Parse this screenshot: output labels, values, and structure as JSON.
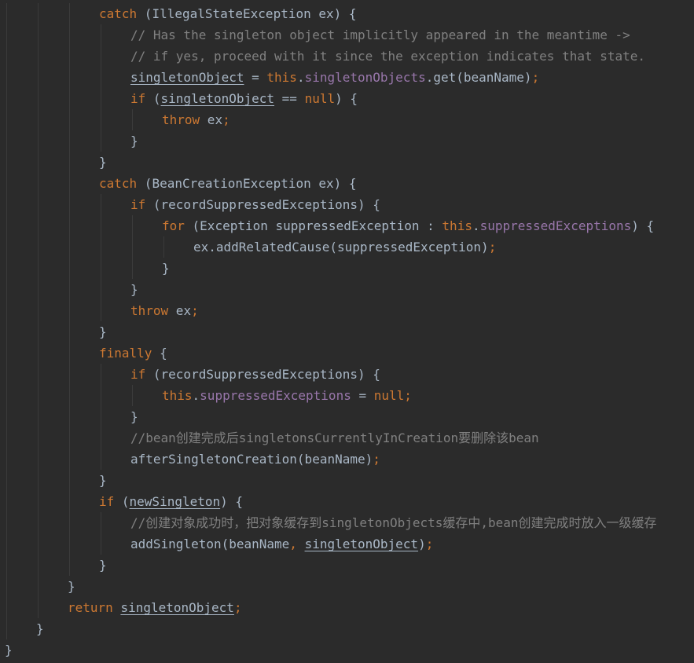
{
  "editor": {
    "language": "Java",
    "theme_colors": {
      "background": "#2b2b2b",
      "plain": "#a9b7c6",
      "keyword": "#cc7832",
      "field": "#9876aa",
      "comment": "#808080",
      "indent_guide": "#3b3b3b"
    },
    "lines": [
      {
        "indent": 3,
        "tokens": [
          {
            "t": "kw",
            "v": "catch"
          },
          {
            "t": "plain",
            "v": " (IllegalStateException ex) {"
          }
        ]
      },
      {
        "indent": 4,
        "tokens": [
          {
            "t": "comment",
            "v": "// Has the singleton object implicitly appeared in the meantime ->"
          }
        ]
      },
      {
        "indent": 4,
        "tokens": [
          {
            "t": "comment",
            "v": "// if yes, proceed with it since the exception indicates that state."
          }
        ]
      },
      {
        "indent": 4,
        "tokens": [
          {
            "t": "plain",
            "v": "singletonObject",
            "u": true
          },
          {
            "t": "plain",
            "v": " = "
          },
          {
            "t": "kw",
            "v": "this"
          },
          {
            "t": "plain",
            "v": "."
          },
          {
            "t": "field",
            "v": "singletonObjects"
          },
          {
            "t": "plain",
            "v": ".get(beanName)"
          },
          {
            "t": "kw",
            "v": ";"
          }
        ]
      },
      {
        "indent": 4,
        "tokens": [
          {
            "t": "kw",
            "v": "if"
          },
          {
            "t": "plain",
            "v": " ("
          },
          {
            "t": "plain",
            "v": "singletonObject",
            "u": true
          },
          {
            "t": "plain",
            "v": " == "
          },
          {
            "t": "kw",
            "v": "null"
          },
          {
            "t": "plain",
            "v": ") {"
          }
        ]
      },
      {
        "indent": 5,
        "tokens": [
          {
            "t": "kw",
            "v": "throw"
          },
          {
            "t": "plain",
            "v": " ex"
          },
          {
            "t": "kw",
            "v": ";"
          }
        ]
      },
      {
        "indent": 4,
        "tokens": [
          {
            "t": "plain",
            "v": "}"
          }
        ]
      },
      {
        "indent": 3,
        "tokens": [
          {
            "t": "plain",
            "v": "}"
          }
        ]
      },
      {
        "indent": 3,
        "tokens": [
          {
            "t": "kw",
            "v": "catch"
          },
          {
            "t": "plain",
            "v": " (BeanCreationException ex) {"
          }
        ]
      },
      {
        "indent": 4,
        "tokens": [
          {
            "t": "kw",
            "v": "if"
          },
          {
            "t": "plain",
            "v": " (recordSuppressedExceptions) {"
          }
        ]
      },
      {
        "indent": 5,
        "tokens": [
          {
            "t": "kw",
            "v": "for"
          },
          {
            "t": "plain",
            "v": " (Exception suppressedException : "
          },
          {
            "t": "kw",
            "v": "this"
          },
          {
            "t": "plain",
            "v": "."
          },
          {
            "t": "field",
            "v": "suppressedExceptions"
          },
          {
            "t": "plain",
            "v": ") {"
          }
        ]
      },
      {
        "indent": 6,
        "tokens": [
          {
            "t": "plain",
            "v": "ex.addRelatedCause(suppressedException)"
          },
          {
            "t": "kw",
            "v": ";"
          }
        ]
      },
      {
        "indent": 5,
        "tokens": [
          {
            "t": "plain",
            "v": "}"
          }
        ]
      },
      {
        "indent": 4,
        "tokens": [
          {
            "t": "plain",
            "v": "}"
          }
        ]
      },
      {
        "indent": 4,
        "tokens": [
          {
            "t": "kw",
            "v": "throw"
          },
          {
            "t": "plain",
            "v": " ex"
          },
          {
            "t": "kw",
            "v": ";"
          }
        ]
      },
      {
        "indent": 3,
        "tokens": [
          {
            "t": "plain",
            "v": "}"
          }
        ]
      },
      {
        "indent": 3,
        "tokens": [
          {
            "t": "kw",
            "v": "finally"
          },
          {
            "t": "plain",
            "v": " {"
          }
        ]
      },
      {
        "indent": 4,
        "tokens": [
          {
            "t": "kw",
            "v": "if"
          },
          {
            "t": "plain",
            "v": " (recordSuppressedExceptions) {"
          }
        ]
      },
      {
        "indent": 5,
        "tokens": [
          {
            "t": "kw",
            "v": "this"
          },
          {
            "t": "plain",
            "v": "."
          },
          {
            "t": "field",
            "v": "suppressedExceptions"
          },
          {
            "t": "plain",
            "v": " = "
          },
          {
            "t": "kw",
            "v": "null;"
          }
        ]
      },
      {
        "indent": 4,
        "tokens": [
          {
            "t": "plain",
            "v": "}"
          }
        ]
      },
      {
        "indent": 4,
        "tokens": [
          {
            "t": "comment",
            "v": "//bean创建完成后singletonsCurrentlyInCreation要删除该bean"
          }
        ]
      },
      {
        "indent": 4,
        "tokens": [
          {
            "t": "plain",
            "v": "afterSingletonCreation(beanName)"
          },
          {
            "t": "kw",
            "v": ";"
          }
        ]
      },
      {
        "indent": 3,
        "tokens": [
          {
            "t": "plain",
            "v": "}"
          }
        ]
      },
      {
        "indent": 3,
        "tokens": [
          {
            "t": "kw",
            "v": "if"
          },
          {
            "t": "plain",
            "v": " ("
          },
          {
            "t": "plain",
            "v": "newSingleton",
            "u": true
          },
          {
            "t": "plain",
            "v": ") {"
          }
        ]
      },
      {
        "indent": 4,
        "tokens": [
          {
            "t": "comment",
            "v": "//创建对象成功时，把对象缓存到singletonObjects缓存中,bean创建完成时放入一级缓存"
          }
        ]
      },
      {
        "indent": 4,
        "tokens": [
          {
            "t": "plain",
            "v": "addSingleton(beanName"
          },
          {
            "t": "kw",
            "v": ", "
          },
          {
            "t": "plain",
            "v": "singletonObject",
            "u": true
          },
          {
            "t": "plain",
            "v": ")"
          },
          {
            "t": "kw",
            "v": ";"
          }
        ]
      },
      {
        "indent": 3,
        "tokens": [
          {
            "t": "plain",
            "v": "}"
          }
        ]
      },
      {
        "indent": 2,
        "tokens": [
          {
            "t": "plain",
            "v": "}"
          }
        ]
      },
      {
        "indent": 2,
        "tokens": [
          {
            "t": "kw",
            "v": "return"
          },
          {
            "t": "plain",
            "v": " "
          },
          {
            "t": "plain",
            "v": "singletonObject",
            "u": true
          },
          {
            "t": "kw",
            "v": ";"
          }
        ]
      },
      {
        "indent": 1,
        "tokens": [
          {
            "t": "plain",
            "v": "}"
          }
        ]
      },
      {
        "indent": 0,
        "tokens": [
          {
            "t": "plain",
            "v": "}"
          }
        ]
      }
    ]
  }
}
